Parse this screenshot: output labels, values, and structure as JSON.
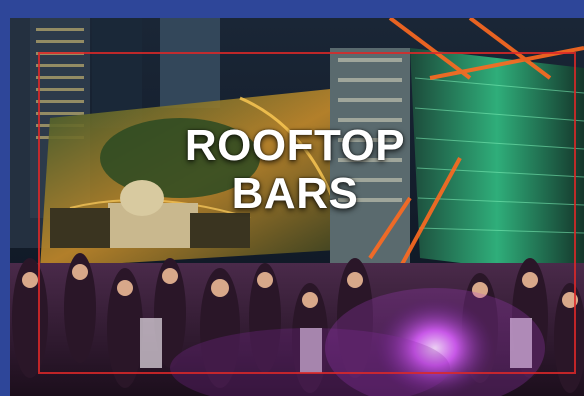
{
  "card": {
    "title_line1": "ROOFTOP",
    "title_line2": "BARS"
  },
  "colors": {
    "border": "#2e4699",
    "frame": "#dc2828",
    "night_sky": "#0e1a2a",
    "neon_purple": "#c040e0",
    "city_glow": "#f2b840"
  }
}
